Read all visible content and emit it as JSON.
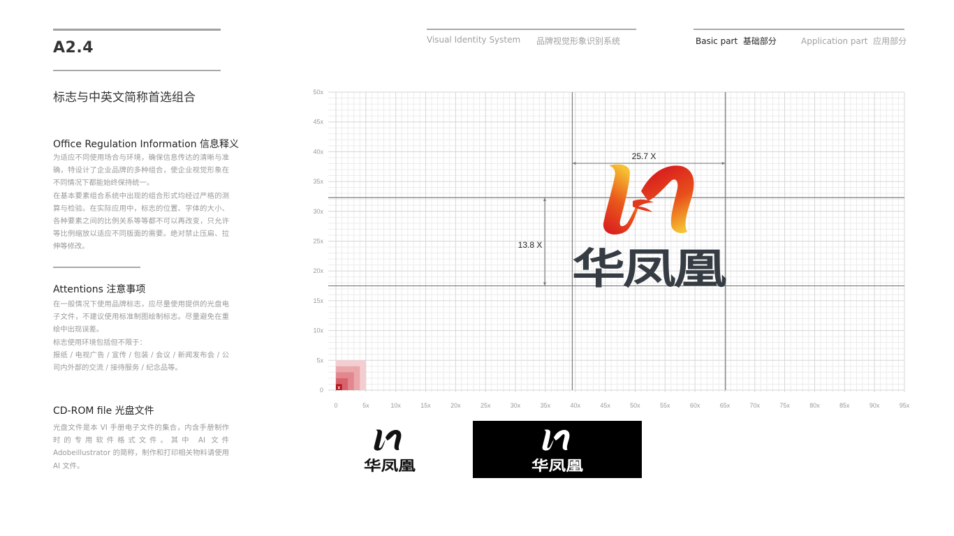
{
  "section": {
    "code": "A2.4",
    "title": "标志与中英文简称首选组合"
  },
  "header": {
    "vis_en": "Visual Identity System",
    "vis_cn": "品牌视觉形象识别系统",
    "basic_en": "Basic part",
    "basic_cn": "基础部分",
    "app_en": "Application part",
    "app_cn": "应用部分"
  },
  "blocks": {
    "regulation": {
      "title": "Office Regulation Information 信息释义",
      "p1": "为适应不同使用场合与环境，确保信息传达的清晰与准确，特设计了企业品牌的多种组合，使企业视觉形象在不同情况下都能始终保持统一。",
      "p2": "在基本要素组合系统中出现的组合形式均经过严格的测算与检验。在实际应用中，标志的位置、字体的大小、各种要素之间的比例关系等等都不可以再改变，只允许等比例缩放以适应不同版面的需要。绝对禁止压扁、拉伸等修改。"
    },
    "attentions": {
      "title": "Attentions 注意事项",
      "p1": "在一般情况下使用品牌标志，应尽量使用提供的光盘电子文件，不建议使用标准制图绘制标志。尽量避免在重绘中出现误差。",
      "p2": "标志使用环境包括但不限于：",
      "p3": "报纸 / 电视广告 / 宣传 / 包装 / 会议 / 新闻发布会 / 公司内外部的交流 / 接待服务 / 纪念品等。"
    },
    "cdrom": {
      "title": "CD-ROM file 光盘文件",
      "p1": "光盘文件是本 VI 手册电子文件的集合，内含手册制作时的专用软件格式文件。其中 AI 文件 Adobeillustrator 的简称，制作和打印相关物料请使用 AI 文件。"
    }
  },
  "grid": {
    "x_range": [
      0,
      95
    ],
    "y_range": [
      0,
      50
    ],
    "major_step": 5,
    "minor_step": 1,
    "x_ticks": [
      "0",
      "5x",
      "10x",
      "15x",
      "20x",
      "25x",
      "30x",
      "35x",
      "40x",
      "45x",
      "50x",
      "55x",
      "60x",
      "65x",
      "70x",
      "75x",
      "80x",
      "85x",
      "90x",
      "95x"
    ],
    "y_ticks": [
      "0",
      "5x",
      "10x",
      "15x",
      "20x",
      "25x",
      "30x",
      "35x",
      "40x",
      "45x",
      "50x"
    ],
    "unit_marker": "x",
    "unit_swatch_levels": [
      1,
      2,
      3,
      4,
      5
    ],
    "guides": {
      "vertical": [
        39.5,
        65.1
      ],
      "horizontal": [
        32.3,
        17.5
      ]
    },
    "dimensions": {
      "width_label": "25.7 X",
      "height_label": "13.8 X"
    }
  },
  "logo": {
    "name_cn": "华凤凰",
    "colors": {
      "red": "#d7171f",
      "orange": "#ef7a1a",
      "yellow": "#f6c232",
      "wordmark": "#363c43"
    }
  },
  "variants": {
    "mono_black_bg": "#ffffff",
    "mono_white_bg": "#000000"
  }
}
